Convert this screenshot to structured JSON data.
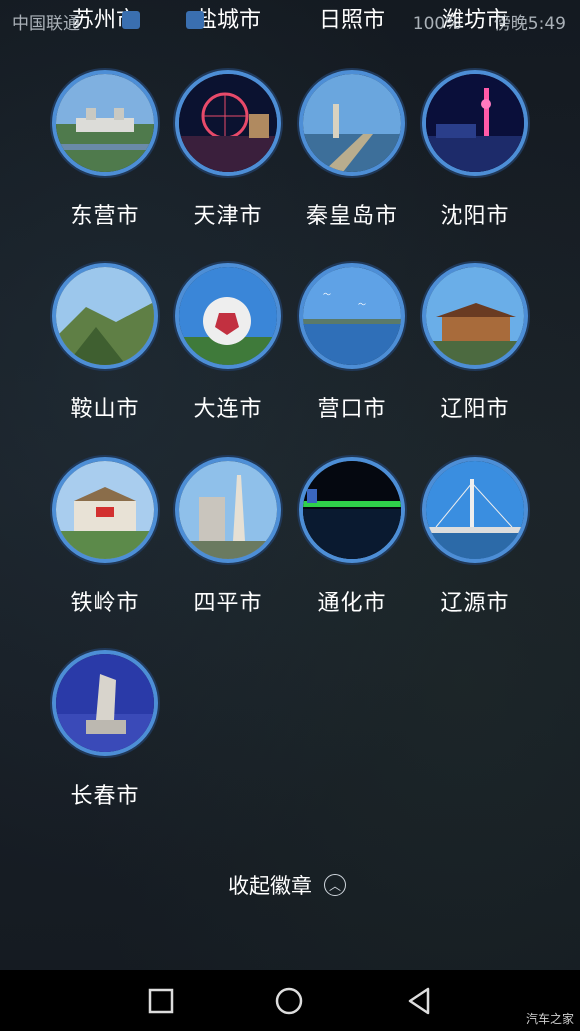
{
  "status_bar": {
    "carrier": "中国联通",
    "right_text": "100%",
    "time": "傍晚5:49"
  },
  "previous_row": [
    "苏州市",
    "盐城市",
    "日照市",
    "潍坊市"
  ],
  "badges": [
    {
      "city": "东营市",
      "icon": "city-plaza-photo"
    },
    {
      "city": "天津市",
      "icon": "ferris-wheel-night-photo"
    },
    {
      "city": "秦皇岛市",
      "icon": "seaside-tower-photo"
    },
    {
      "city": "沈阳市",
      "icon": "tower-night-photo"
    },
    {
      "city": "鞍山市",
      "icon": "mountain-pine-photo"
    },
    {
      "city": "大连市",
      "icon": "football-sculpture-photo"
    },
    {
      "city": "营口市",
      "icon": "sea-gulls-photo"
    },
    {
      "city": "辽阳市",
      "icon": "pagoda-building-photo"
    },
    {
      "city": "铁岭市",
      "icon": "palace-building-photo"
    },
    {
      "city": "四平市",
      "icon": "monument-photo"
    },
    {
      "city": "通化市",
      "icon": "night-waterfront-photo"
    },
    {
      "city": "辽源市",
      "icon": "cable-bridge-photo"
    },
    {
      "city": "长春市",
      "icon": "statue-photo"
    }
  ],
  "collapse_label": "收起徽章",
  "watermark": "汽车之家",
  "colors": {
    "background": "#151b22",
    "badge_ring": "#4d8ed6"
  }
}
